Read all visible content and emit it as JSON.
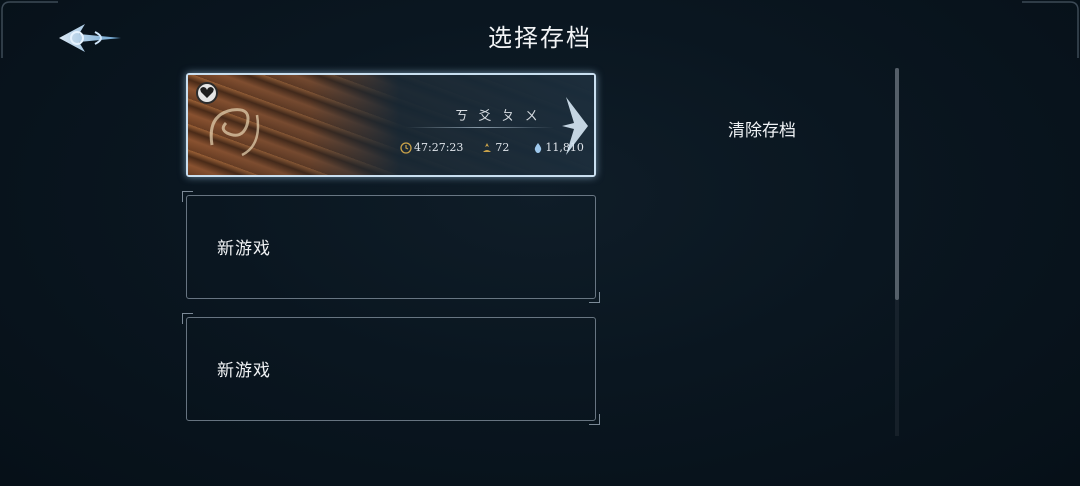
{
  "header": {
    "title": "选择存档",
    "back_icon": "back-arrow-ornament-icon"
  },
  "slots": [
    {
      "state": "saved",
      "name": "ㄎ 爻 ㄆ ㄨ",
      "playtime": "47:27:23",
      "level": "72",
      "currency": "11,810",
      "icons": [
        "clock-icon",
        "level-icon",
        "soul-drop-icon",
        "heart-badge-icon"
      ]
    },
    {
      "state": "empty",
      "label": "新游戏"
    },
    {
      "state": "empty",
      "label": "新游戏"
    }
  ],
  "actions": {
    "clear_label": "清除存档"
  },
  "colors": {
    "accent_glow": "#c9dff0",
    "background": "#0a1620",
    "text": "#f0f2f4",
    "clock_gold": "#c9a24a"
  }
}
